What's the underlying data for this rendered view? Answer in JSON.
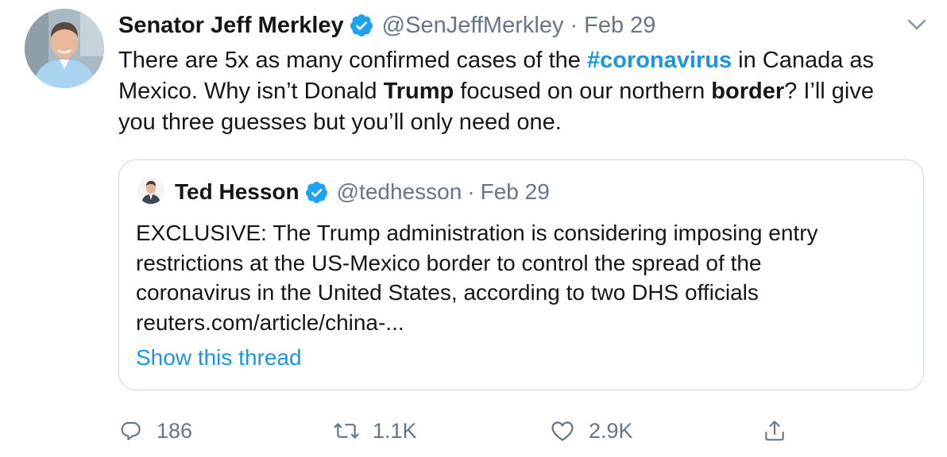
{
  "tweet": {
    "author_name": "Senator Jeff Merkley",
    "author_handle": "@SenJeffMerkley",
    "separator": "·",
    "date": "Feb 29",
    "body": {
      "line1_before": "There are 5x as many confirmed cases of the ",
      "hashtag": "#coronavirus",
      "line1_after": " in Canada as",
      "line2_before": "Mexico. Why isn’t Donald ",
      "bold_trump": "Trump",
      "line2_middle": " focused on our northern ",
      "bold_border": "border",
      "line2_after": "? I’ll give",
      "line3": "you three guesses but you’ll only need one."
    }
  },
  "quoted_tweet": {
    "author_name": "Ted Hesson",
    "author_handle": "@tedhesson",
    "separator": "·",
    "date": "Feb 29",
    "lines": [
      "EXCLUSIVE: The Trump administration is considering imposing entry",
      "restrictions at the US-Mexico border to control the spread of the",
      "coronavirus in the United States, according to two DHS officials",
      "reuters.com/article/china-..."
    ],
    "show_thread": "Show this thread"
  },
  "actions": {
    "reply_count": "186",
    "retweet_count": "1.1K",
    "like_count": "2.9K"
  },
  "icons": {
    "verified": "verified-badge-icon",
    "chevron": "chevron-down-icon",
    "reply": "reply-icon",
    "retweet": "retweet-icon",
    "like": "heart-icon",
    "share": "share-icon"
  },
  "colors": {
    "link_blue": "#1b95e0",
    "muted_gray": "#657786",
    "text": "#14171a",
    "border": "#ccd6dd"
  }
}
